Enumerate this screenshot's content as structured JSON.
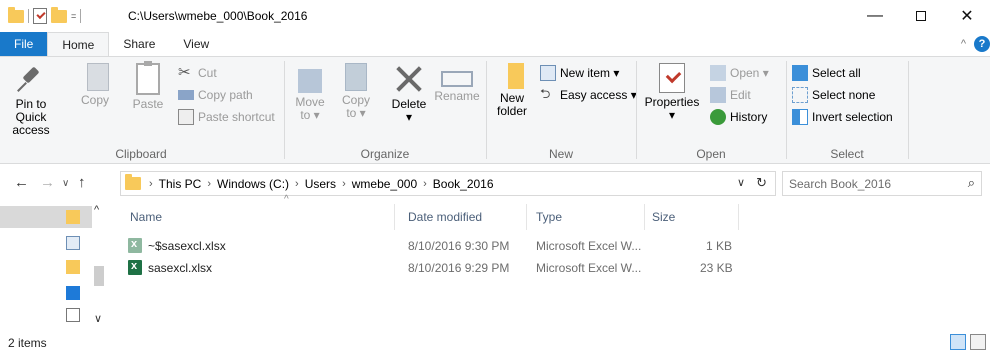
{
  "window": {
    "title": "C:\\Users\\wmebe_000\\Book_2016",
    "qat_dropdown": "="
  },
  "tabs": [
    {
      "label": "File"
    },
    {
      "label": "Home"
    },
    {
      "label": "Share"
    },
    {
      "label": "View"
    }
  ],
  "ribbon": {
    "clipboard": {
      "pin_label_1": "Pin to Quick",
      "pin_label_2": "access",
      "copy": "Copy",
      "paste": "Paste",
      "cut": "Cut",
      "copy_path": "Copy path",
      "paste_shortcut": "Paste shortcut",
      "group": "Clipboard"
    },
    "organize": {
      "move_1": "Move",
      "move_2": "to ▾",
      "copy_1": "Copy",
      "copy_2": "to ▾",
      "delete": "Delete",
      "delete_dd": "▾",
      "rename": "Rename",
      "group": "Organize"
    },
    "new": {
      "new_folder_1": "New",
      "new_folder_2": "folder",
      "new_item": "New item ▾",
      "easy_access": "Easy access ▾",
      "group": "New"
    },
    "open": {
      "properties": "Properties",
      "properties_dd": "▾",
      "open": "Open ▾",
      "edit": "Edit",
      "history": "History",
      "group": "Open"
    },
    "select": {
      "select_all": "Select all",
      "select_none": "Select none",
      "invert": "Invert selection",
      "group": "Select"
    }
  },
  "address": {
    "crumbs": [
      "This PC",
      "Windows (C:)",
      "Users",
      "wmebe_000",
      "Book_2016"
    ],
    "search_placeholder": "Search Book_2016"
  },
  "columns": {
    "name": "Name",
    "date": "Date modified",
    "type": "Type",
    "size": "Size"
  },
  "files": [
    {
      "name": "~$sasexcl.xlsx",
      "date": "8/10/2016 9:30 PM",
      "type": "Microsoft Excel W...",
      "size": "1 KB"
    },
    {
      "name": "sasexcl.xlsx",
      "date": "8/10/2016 9:29 PM",
      "type": "Microsoft Excel W...",
      "size": "23 KB"
    }
  ],
  "status": {
    "items": "2 items"
  },
  "icons": {
    "excel_color": "#1e7145",
    "accent": "#1979ca"
  }
}
